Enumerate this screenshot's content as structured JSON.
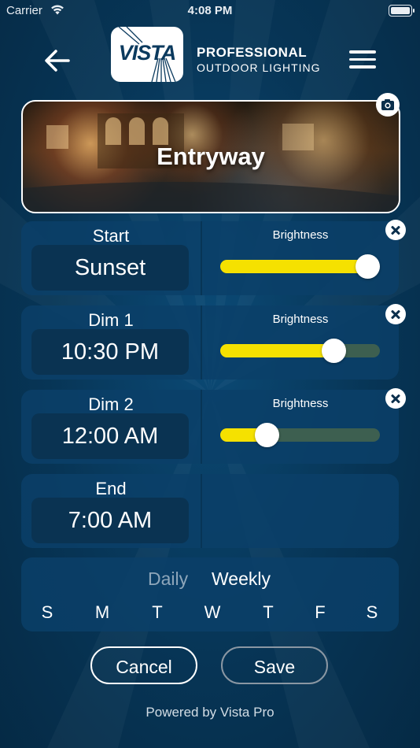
{
  "status_bar": {
    "carrier": "Carrier",
    "time": "4:08 PM"
  },
  "header": {
    "logo_text": "VISTA",
    "brand_line1": "PROFESSIONAL",
    "brand_line2": "OUTDOOR LIGHTING"
  },
  "zone": {
    "name": "Entryway"
  },
  "schedule": [
    {
      "label": "Start",
      "time": "Sunset",
      "brightness_label": "Brightness",
      "brightness": 0.92,
      "removable": true
    },
    {
      "label": "Dim 1",
      "time": "10:30 PM",
      "brightness_label": "Brightness",
      "brightness": 0.71,
      "removable": true
    },
    {
      "label": "Dim 2",
      "time": "12:00 AM",
      "brightness_label": "Brightness",
      "brightness": 0.29,
      "removable": true
    },
    {
      "label": "End",
      "time": "7:00 AM",
      "removable": false
    }
  ],
  "recurrence": {
    "options": [
      "Daily",
      "Weekly"
    ],
    "selected": "Weekly",
    "days": [
      "S",
      "M",
      "T",
      "W",
      "T",
      "F",
      "S"
    ]
  },
  "actions": {
    "cancel": "Cancel",
    "save": "Save"
  },
  "footer": "Powered by Vista Pro",
  "colors": {
    "accent": "#f5e100",
    "track": "#3d5f50",
    "background": "#073556"
  }
}
